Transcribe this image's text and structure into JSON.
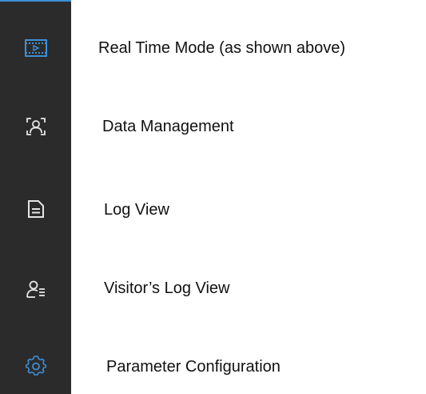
{
  "colors": {
    "sidebar_bg": "#2b2b2b",
    "active_icon": "#3d8fd6",
    "inactive_icon": "#e6e6e6"
  },
  "sidebar": {
    "items": [
      {
        "icon": "film-play-icon",
        "active": true
      },
      {
        "icon": "user-scan-icon",
        "active": false
      },
      {
        "icon": "document-icon",
        "active": false
      },
      {
        "icon": "user-list-icon",
        "active": false
      },
      {
        "icon": "gear-icon",
        "active": false
      }
    ]
  },
  "descriptions": {
    "real_time_mode": "Real Time Mode (as shown above)",
    "data_management": "Data Management",
    "log_view": "Log View",
    "visitors_log_view": "Visitor’s Log View",
    "parameter_configuration": "Parameter Configuration"
  }
}
